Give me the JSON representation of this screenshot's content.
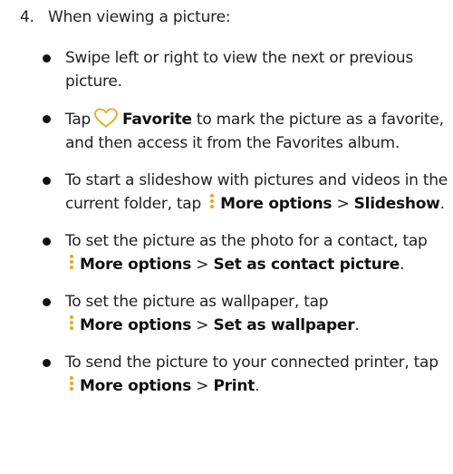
{
  "step": {
    "number": "4.",
    "text": "When viewing a picture:"
  },
  "bullets": {
    "b1": {
      "text": "Swipe left or right to view the next or previous picture."
    },
    "b2": {
      "pre": "Tap",
      "bold": "Favorite",
      "post": "to mark the picture as a favorite, and then access it from the Favorites album.",
      "icon": "heart-outline-icon"
    },
    "b3": {
      "pre": "To start a slideshow with pictures and videos in the current folder, tap",
      "bold1": "More options",
      "sep": ">",
      "bold2": "Slideshow",
      "end": ".",
      "icon": "more-options-vertical-dots-icon"
    },
    "b4": {
      "pre": "To set the picture as the photo for a contact, tap",
      "bold1": "More options",
      "sep": ">",
      "bold2": "Set as contact picture",
      "end": ".",
      "icon": "more-options-vertical-dots-icon"
    },
    "b5": {
      "pre": "To set the picture as wallpaper, tap",
      "bold1": "More options",
      "sep": ">",
      "bold2": "Set as wallpaper",
      "end": ".",
      "icon": "more-options-vertical-dots-icon"
    },
    "b6": {
      "pre": "To send the picture to your connected printer, tap",
      "bold1": "More options",
      "sep": ">",
      "bold2": "Print",
      "end": ".",
      "icon": "more-options-vertical-dots-icon"
    }
  },
  "colors": {
    "text": "#222222",
    "bullet": "#111111",
    "heart_icon": "#e6a817",
    "more_options_icon": "#e6a817"
  }
}
